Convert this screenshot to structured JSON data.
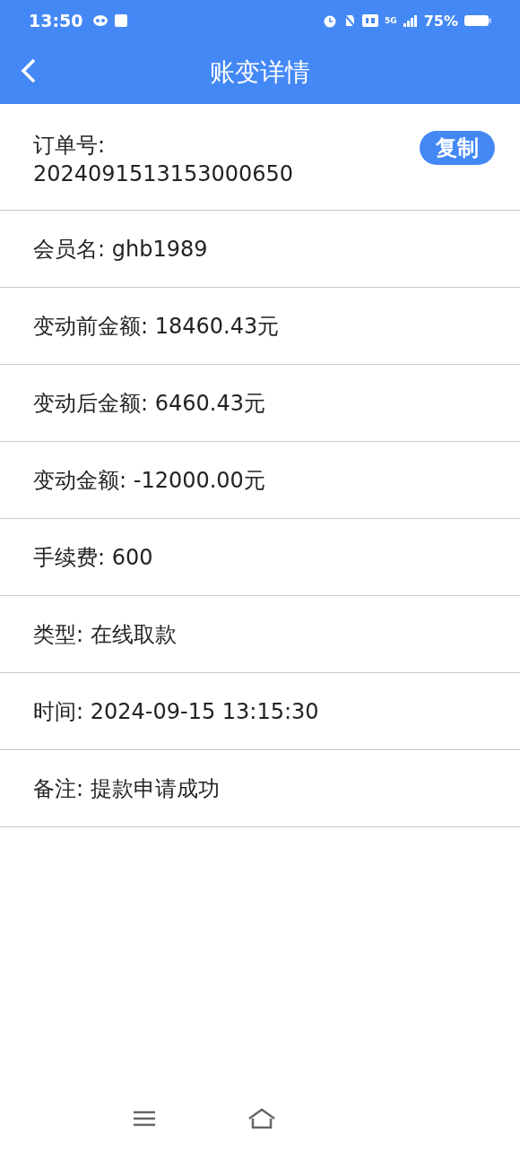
{
  "status_bar": {
    "time": "13:50",
    "battery": "75%",
    "network": "5G"
  },
  "header": {
    "title": "账变详情"
  },
  "order": {
    "label": "订单号:",
    "value": "2024091513153000650",
    "button": "复制"
  },
  "fields": [
    {
      "text": "会员名: ghb1989"
    },
    {
      "text": "变动前金额: 18460.43元"
    },
    {
      "text": "变动后金额: 6460.43元"
    },
    {
      "text": "变动金额: -12000.00元"
    },
    {
      "text": "手续费: 600"
    },
    {
      "text": "类型: 在线取款"
    },
    {
      "text": "时间: 2024-09-15 13:15:30"
    },
    {
      "text": "备注: 提款申请成功"
    }
  ]
}
